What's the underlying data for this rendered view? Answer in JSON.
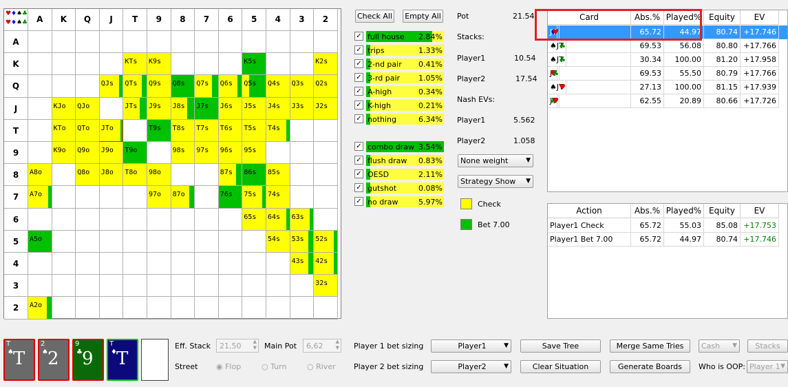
{
  "grid": {
    "ranks": [
      "A",
      "K",
      "Q",
      "J",
      "T",
      "9",
      "8",
      "7",
      "6",
      "5",
      "4",
      "3",
      "2"
    ],
    "cells": [
      {
        "r": 1,
        "c": 4,
        "label": "KTs",
        "yellow": 1.0,
        "green": 0
      },
      {
        "r": 1,
        "c": 5,
        "label": "K9s",
        "yellow": 1.0,
        "green": 0
      },
      {
        "r": 1,
        "c": 9,
        "label": "K5s",
        "yellow": 0,
        "green": 1.0
      },
      {
        "r": 1,
        "c": 12,
        "label": "K2s",
        "yellow": 1.0,
        "green": 0
      },
      {
        "r": 2,
        "c": 3,
        "label": "QJs",
        "yellow": 0.85,
        "green": 0.15
      },
      {
        "r": 2,
        "c": 4,
        "label": "QTs",
        "yellow": 0.8,
        "green": 0.2
      },
      {
        "r": 2,
        "c": 5,
        "label": "Q9s",
        "yellow": 1.0,
        "green": 0
      },
      {
        "r": 2,
        "c": 6,
        "label": "Q8s",
        "yellow": 0,
        "green": 1.0
      },
      {
        "r": 2,
        "c": 7,
        "label": "Q7s",
        "yellow": 0.75,
        "green": 0.25
      },
      {
        "r": 2,
        "c": 8,
        "label": "Q6s",
        "yellow": 0.8,
        "green": 0.2
      },
      {
        "r": 2,
        "c": 9,
        "label": "Q5s",
        "yellow": 0.3,
        "green": 0.7
      },
      {
        "r": 2,
        "c": 10,
        "label": "Q4s",
        "yellow": 1.0,
        "green": 0
      },
      {
        "r": 2,
        "c": 11,
        "label": "Q3s",
        "yellow": 1.0,
        "green": 0
      },
      {
        "r": 2,
        "c": 12,
        "label": "Q2s",
        "yellow": 1.0,
        "green": 0
      },
      {
        "r": 3,
        "c": 1,
        "label": "KJo",
        "yellow": 1.0,
        "green": 0
      },
      {
        "r": 3,
        "c": 2,
        "label": "QJo",
        "yellow": 1.0,
        "green": 0
      },
      {
        "r": 3,
        "c": 4,
        "label": "JTs",
        "yellow": 0.7,
        "green": 0.3
      },
      {
        "r": 3,
        "c": 5,
        "label": "J9s",
        "yellow": 1.0,
        "green": 0
      },
      {
        "r": 3,
        "c": 6,
        "label": "J8s",
        "yellow": 0.7,
        "green": 0.3
      },
      {
        "r": 3,
        "c": 7,
        "label": "J7s",
        "yellow": 0,
        "green": 1.0
      },
      {
        "r": 3,
        "c": 8,
        "label": "J6s",
        "yellow": 1.0,
        "green": 0
      },
      {
        "r": 3,
        "c": 9,
        "label": "J5s",
        "yellow": 1.0,
        "green": 0
      },
      {
        "r": 3,
        "c": 10,
        "label": "J4s",
        "yellow": 1.0,
        "green": 0
      },
      {
        "r": 3,
        "c": 11,
        "label": "J3s",
        "yellow": 1.0,
        "green": 0
      },
      {
        "r": 3,
        "c": 12,
        "label": "J2s",
        "yellow": 1.0,
        "green": 0
      },
      {
        "r": 4,
        "c": 1,
        "label": "KTo",
        "yellow": 1.0,
        "green": 0
      },
      {
        "r": 4,
        "c": 2,
        "label": "QTo",
        "yellow": 1.0,
        "green": 0
      },
      {
        "r": 4,
        "c": 3,
        "label": "JTo",
        "yellow": 0.9,
        "green": 0.1,
        "selected": true
      },
      {
        "r": 4,
        "c": 5,
        "label": "T9s",
        "yellow": 0,
        "green": 1.0
      },
      {
        "r": 4,
        "c": 6,
        "label": "T8s",
        "yellow": 1.0,
        "green": 0
      },
      {
        "r": 4,
        "c": 7,
        "label": "T7s",
        "yellow": 1.0,
        "green": 0
      },
      {
        "r": 4,
        "c": 8,
        "label": "T6s",
        "yellow": 1.0,
        "green": 0
      },
      {
        "r": 4,
        "c": 9,
        "label": "T5s",
        "yellow": 1.0,
        "green": 0
      },
      {
        "r": 4,
        "c": 10,
        "label": "T4s",
        "yellow": 0.85,
        "green": 0.15
      },
      {
        "r": 5,
        "c": 1,
        "label": "K9o",
        "yellow": 1.0,
        "green": 0
      },
      {
        "r": 5,
        "c": 2,
        "label": "Q9o",
        "yellow": 1.0,
        "green": 0
      },
      {
        "r": 5,
        "c": 3,
        "label": "J9o",
        "yellow": 1.0,
        "green": 0
      },
      {
        "r": 5,
        "c": 4,
        "label": "T9o",
        "yellow": 0,
        "green": 1.0
      },
      {
        "r": 5,
        "c": 6,
        "label": "98s",
        "yellow": 1.0,
        "green": 0
      },
      {
        "r": 5,
        "c": 7,
        "label": "97s",
        "yellow": 1.0,
        "green": 0
      },
      {
        "r": 5,
        "c": 8,
        "label": "96s",
        "yellow": 1.0,
        "green": 0
      },
      {
        "r": 5,
        "c": 9,
        "label": "95s",
        "yellow": 1.0,
        "green": 0
      },
      {
        "r": 6,
        "c": 0,
        "label": "A8o",
        "yellow": 1.0,
        "green": 0
      },
      {
        "r": 6,
        "c": 2,
        "label": "Q8o",
        "yellow": 1.0,
        "green": 0
      },
      {
        "r": 6,
        "c": 3,
        "label": "J8o",
        "yellow": 1.0,
        "green": 0
      },
      {
        "r": 6,
        "c": 4,
        "label": "T8o",
        "yellow": 1.0,
        "green": 0
      },
      {
        "r": 6,
        "c": 5,
        "label": "98o",
        "yellow": 1.0,
        "green": 0
      },
      {
        "r": 6,
        "c": 8,
        "label": "87s",
        "yellow": 0.75,
        "green": 0.25
      },
      {
        "r": 6,
        "c": 9,
        "label": "86s",
        "yellow": 0,
        "green": 1.0
      },
      {
        "r": 6,
        "c": 9,
        "label": "85s",
        "yellow": 1.0,
        "green": 0,
        "shift": 1
      },
      {
        "r": 7,
        "c": 0,
        "label": "A7o",
        "yellow": 0.85,
        "green": 0.15
      },
      {
        "r": 7,
        "c": 5,
        "label": "97o",
        "yellow": 1.0,
        "green": 0
      },
      {
        "r": 7,
        "c": 6,
        "label": "87o",
        "yellow": 0.8,
        "green": 0.2
      },
      {
        "r": 7,
        "c": 8,
        "label": "76s",
        "yellow": 0,
        "green": 1.0
      },
      {
        "r": 7,
        "c": 9,
        "label": "75s",
        "yellow": 0.85,
        "green": 0.15
      },
      {
        "r": 7,
        "c": 10,
        "label": "74s",
        "yellow": 1.0,
        "green": 0
      },
      {
        "r": 8,
        "c": 9,
        "label": "65s",
        "yellow": 1.0,
        "green": 0
      },
      {
        "r": 8,
        "c": 10,
        "label": "64s",
        "yellow": 0.85,
        "green": 0.15
      },
      {
        "r": 8,
        "c": 11,
        "label": "63s",
        "yellow": 0.85,
        "green": 0.15
      },
      {
        "r": 9,
        "c": 0,
        "label": "A5o",
        "yellow": 0,
        "green": 1.0
      },
      {
        "r": 9,
        "c": 10,
        "label": "54s",
        "yellow": 1.0,
        "green": 0
      },
      {
        "r": 9,
        "c": 11,
        "label": "53s",
        "yellow": 0.8,
        "green": 0.2
      },
      {
        "r": 9,
        "c": 12,
        "label": "52s",
        "yellow": 0.85,
        "green": 0.15
      },
      {
        "r": 10,
        "c": 11,
        "label": "43s",
        "yellow": 0.8,
        "green": 0.2
      },
      {
        "r": 10,
        "c": 12,
        "label": "42s",
        "yellow": 0.85,
        "green": 0.15
      },
      {
        "r": 11,
        "c": 12,
        "label": "32s",
        "yellow": 1.0,
        "green": 0
      },
      {
        "r": 12,
        "c": 0,
        "label": "A2o",
        "yellow": 0.8,
        "green": 0.2
      }
    ]
  },
  "buttons": {
    "check_all": "Check All",
    "empty_all": "Empty All"
  },
  "filters_made": [
    {
      "name": "full house",
      "pct": "2.84%",
      "green": 0.85
    },
    {
      "name": "trips",
      "pct": "1.33%",
      "green": 0
    },
    {
      "name": "2-nd pair",
      "pct": "0.41%",
      "green": 0
    },
    {
      "name": "3-rd pair",
      "pct": "1.05%",
      "green": 0
    },
    {
      "name": "A-high",
      "pct": "0.34%",
      "green": 0
    },
    {
      "name": "K-high",
      "pct": "0.21%",
      "green": 0
    },
    {
      "name": "nothing",
      "pct": "6.34%",
      "green": 0
    }
  ],
  "filters_draw": [
    {
      "name": "combo draw",
      "pct": "3.54%",
      "green": 1.0
    },
    {
      "name": "flush draw",
      "pct": "0.83%",
      "green": 0
    },
    {
      "name": "OESD",
      "pct": "2.11%",
      "green": 0
    },
    {
      "name": "gutshot",
      "pct": "0.08%",
      "green": 0
    },
    {
      "name": "no draw",
      "pct": "5.97%",
      "green": 0
    }
  ],
  "info": {
    "pot_label": "Pot",
    "pot_value": "21.54",
    "stacks_label": "Stacks:",
    "p1_label": "Player1",
    "p1_stack": "10.54",
    "p2_label": "Player2",
    "p2_stack": "17.54",
    "nash_label": "Nash EVs:",
    "p1_ev": "5.562",
    "p2_ev": "1.058",
    "weight_select": "None weight",
    "strategy_select": "Strategy Show",
    "legend_check": "Check",
    "legend_bet": "Bet 7.00"
  },
  "colors": {
    "check": "#ffff00",
    "bet": "#00c000",
    "highlight": "#3399ff",
    "red_box": "#e02020"
  },
  "card_table": {
    "headers": [
      "Card",
      "Abs.%",
      "Played%",
      "Equity",
      "EV"
    ],
    "rows": [
      {
        "card": "♦J♥T",
        "abs": "65.72",
        "played": "44.97",
        "equity": "80.74",
        "ev": "+17.746",
        "selected": true
      },
      {
        "card": "♠J♣T",
        "abs": "69.53",
        "played": "56.08",
        "equity": "80.80",
        "ev": "+17.766"
      },
      {
        "card": "♠J♣T",
        "abs": "30.34",
        "played": "100.00",
        "equity": "81.20",
        "ev": "+17.958"
      },
      {
        "card": "♥J♣T",
        "abs": "69.53",
        "played": "55.50",
        "equity": "80.79",
        "ev": "+17.766"
      },
      {
        "card": "♠J♥T",
        "abs": "27.13",
        "played": "100.00",
        "equity": "81.15",
        "ev": "+17.939"
      },
      {
        "card": "♣J♥T",
        "abs": "62.55",
        "played": "20.89",
        "equity": "80.66",
        "ev": "+17.726"
      }
    ]
  },
  "action_table": {
    "headers": [
      "Action",
      "Abs.%",
      "Played%",
      "Equity",
      "EV"
    ],
    "rows": [
      {
        "action": "Player1 Check",
        "abs": "65.72",
        "played": "55.03",
        "equity": "85.08",
        "ev": "+17.753"
      },
      {
        "action": "Player1 Bet 7.00",
        "abs": "65.72",
        "played": "44.97",
        "equity": "80.74",
        "ev": "+17.746"
      }
    ]
  },
  "board": [
    {
      "rank": "T",
      "suit": "♠",
      "color": "#6a6a6a",
      "border": "#e00000"
    },
    {
      "rank": "2",
      "suit": "♠",
      "color": "#6a6a6a",
      "border": "#e00000"
    },
    {
      "rank": "9",
      "suit": "♣",
      "color": "#0a6a0a",
      "border": "#e00000"
    },
    {
      "rank": "T",
      "suit": "♦",
      "color": "#0a0a7a",
      "border": "#00c000"
    }
  ],
  "bottom": {
    "eff_stack_label": "Eff. Stack",
    "eff_stack_value": "21,50",
    "main_pot_label": "Main Pot",
    "main_pot_value": "6,62",
    "street_label": "Street",
    "flop": "Flop",
    "turn": "Turn",
    "river": "River",
    "p1_sizing_label": "Player 1 bet sizing",
    "p1_sizing_value": "Player1",
    "p2_sizing_label": "Player 2 bet sizing",
    "p2_sizing_value": "Player2",
    "save_tree": "Save Tree",
    "merge_same_tries": "Merge Same Tries",
    "clear_situation": "Clear Situation",
    "generate_boards": "Generate Boards",
    "cash": "Cash",
    "stacks": "Stacks",
    "who_is_oop": "Who is OOP:",
    "oop_value": "Player 1"
  }
}
